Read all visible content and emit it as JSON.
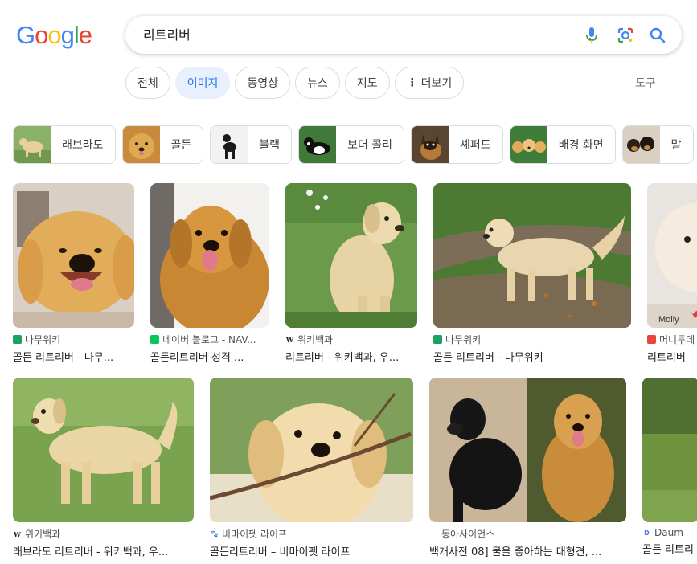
{
  "logo": {
    "letters": [
      "G",
      "o",
      "o",
      "g",
      "l",
      "e"
    ],
    "colors": [
      "#4285F4",
      "#EA4335",
      "#FBBC05",
      "#4285F4",
      "#34A853",
      "#EA4335"
    ]
  },
  "search": {
    "query": "리트리버"
  },
  "tabs": [
    {
      "label": "전체",
      "active": false
    },
    {
      "label": "이미지",
      "active": true
    },
    {
      "label": "동영상",
      "active": false
    },
    {
      "label": "뉴스",
      "active": false
    },
    {
      "label": "지도",
      "active": false
    },
    {
      "label": "더보기",
      "active": false
    }
  ],
  "tools_label": "도구",
  "chips": [
    {
      "label": "래브라도"
    },
    {
      "label": "골든"
    },
    {
      "label": "블랙"
    },
    {
      "label": "보더 콜리"
    },
    {
      "label": "셰퍼드"
    },
    {
      "label": "배경 화면"
    },
    {
      "label": "말"
    }
  ],
  "results": [
    {
      "source": "나무위키",
      "title": "골든 리트리버 - 나무...",
      "fav_color": "#1aa261",
      "fav_text": ""
    },
    {
      "source": "네이버 블로그 - NAV...",
      "title": "골든리트리버 성격 ...",
      "fav_color": "#03c75a",
      "fav_text": ""
    },
    {
      "source": "위키백과",
      "title": "리트리버 - 위키백과, 우...",
      "fav_color": "#ffffff",
      "fav_text": "W"
    },
    {
      "source": "나무위키",
      "title": "골든 리트리버 - 나무위키",
      "fav_color": "#1aa261",
      "fav_text": ""
    },
    {
      "source": "머니투데",
      "title": "리트리버",
      "fav_color": "#e8453c",
      "fav_text": "",
      "overlay": "Molly"
    },
    {
      "source": "위키백과",
      "title": "래브라도 리트리버 - 위키백과, 우...",
      "fav_color": "#ffffff",
      "fav_text": "W"
    },
    {
      "source": "비마이펫 라이프",
      "title": "골든리트리버 – 비마이펫 라이프",
      "fav_color": "#ffffff",
      "fav_text": "🐾"
    },
    {
      "source": "동아사이언스",
      "title": "백개사전 08] 물을 좋아하는 대형견, ...",
      "fav_color": "#ffffff",
      "fav_text": ""
    },
    {
      "source": "Daum",
      "title": "골든 리트리",
      "fav_color": "#ffffff",
      "fav_text": "D"
    }
  ]
}
